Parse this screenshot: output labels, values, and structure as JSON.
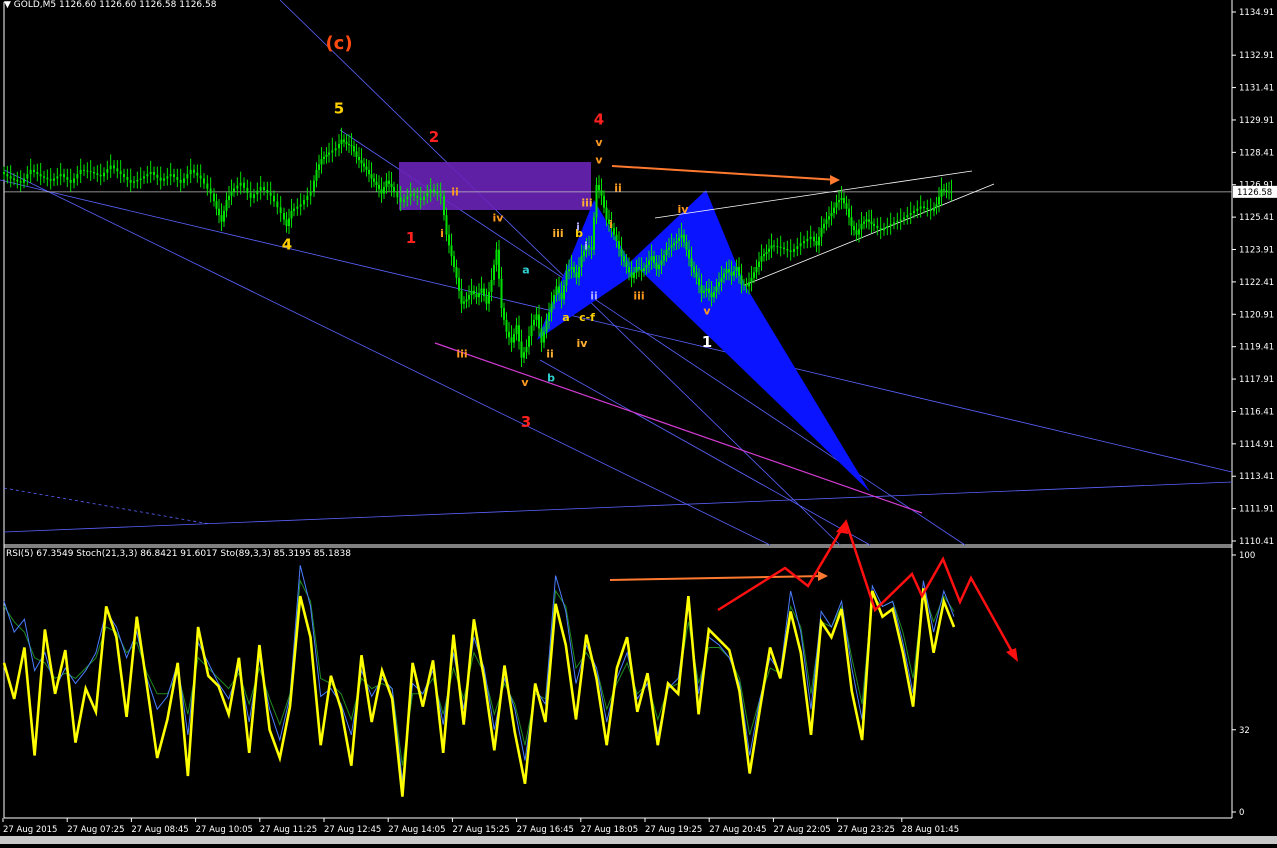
{
  "window": {
    "symbol_label": "GOLD,M5  1126.60 1126.60 1126.58 1126.58",
    "indicator_label": "RSI(5) 67.3549  Stoch(21,3,3) 86.8421 91.6017  Sto(89,3,3) 85.3195 85.1838"
  },
  "colors": {
    "bg": "#000000",
    "candle": "#00e000",
    "grid": "#ffffff",
    "price_line": "#c0c0c0",
    "trend_blue": "#5a63ff",
    "magenta": "#d23cd2",
    "zone_purple": "#6a24b8",
    "pattern_blue": "#0a14ff",
    "rsi_yellow": "#ffff00",
    "arrow_red": "#ff1010",
    "arrow_orange": "#ff7a30"
  },
  "chart_data": [
    {
      "type": "candlestick",
      "symbol": "GOLD",
      "timeframe": "M5",
      "ylim": [
        1110.41,
        1134.91
      ],
      "y_ticks": [
        "1134.91",
        "1132.91",
        "1131.41",
        "1129.91",
        "1128.41",
        "1126.91",
        "1125.41",
        "1123.91",
        "1122.41",
        "1120.91",
        "1119.41",
        "1117.91",
        "1116.41",
        "1114.91",
        "1113.41",
        "1111.91",
        "1110.41"
      ],
      "current_price": "1126.58",
      "x_labels": [
        "27 Aug 2015",
        "27 Aug 07:25",
        "27 Aug 08:45",
        "27 Aug 10:05",
        "27 Aug 11:25",
        "27 Aug 12:45",
        "27 Aug 14:05",
        "27 Aug 15:25",
        "27 Aug 16:45",
        "27 Aug 18:05",
        "27 Aug 19:25",
        "27 Aug 20:45",
        "27 Aug 22:05",
        "27 Aug 23:25",
        "28 Aug 01:45"
      ],
      "close_path": [
        [
          0,
          1127.5
        ],
        [
          10,
          1127.2
        ],
        [
          20,
          1127.0
        ],
        [
          30,
          1127.6
        ],
        [
          40,
          1127.3
        ],
        [
          50,
          1127.1
        ],
        [
          60,
          1127.4
        ],
        [
          70,
          1127.0
        ],
        [
          80,
          1127.6
        ],
        [
          90,
          1127.5
        ],
        [
          100,
          1127.3
        ],
        [
          110,
          1127.8
        ],
        [
          120,
          1127.4
        ],
        [
          130,
          1127.0
        ],
        [
          140,
          1127.2
        ],
        [
          150,
          1127.5
        ],
        [
          160,
          1127.1
        ],
        [
          170,
          1127.4
        ],
        [
          180,
          1127.0
        ],
        [
          190,
          1127.6
        ],
        [
          200,
          1127.2
        ],
        [
          210,
          1126.5
        ],
        [
          215,
          1125.8
        ],
        [
          220,
          1125.2
        ],
        [
          225,
          1126.2
        ],
        [
          230,
          1126.6
        ],
        [
          240,
          1127.0
        ],
        [
          250,
          1126.3
        ],
        [
          260,
          1126.8
        ],
        [
          270,
          1126.4
        ],
        [
          280,
          1125.6
        ],
        [
          285,
          1125.0
        ],
        [
          290,
          1125.7
        ],
        [
          300,
          1126.0
        ],
        [
          310,
          1126.6
        ],
        [
          315,
          1127.6
        ],
        [
          320,
          1128.1
        ],
        [
          325,
          1128.3
        ],
        [
          335,
          1128.6
        ],
        [
          340,
          1129.0
        ],
        [
          345,
          1128.8
        ],
        [
          350,
          1128.7
        ],
        [
          355,
          1128.2
        ],
        [
          360,
          1127.9
        ],
        [
          365,
          1127.6
        ],
        [
          370,
          1127.2
        ],
        [
          375,
          1126.9
        ],
        [
          380,
          1126.5
        ],
        [
          385,
          1127.1
        ],
        [
          390,
          1126.8
        ],
        [
          400,
          1126.1
        ],
        [
          410,
          1126.5
        ],
        [
          420,
          1126.2
        ],
        [
          430,
          1126.7
        ],
        [
          440,
          1126.4
        ],
        [
          445,
          1124.6
        ],
        [
          450,
          1123.6
        ],
        [
          455,
          1122.6
        ],
        [
          460,
          1121.4
        ],
        [
          465,
          1121.6
        ],
        [
          470,
          1122.0
        ],
        [
          475,
          1121.7
        ],
        [
          480,
          1122.1
        ],
        [
          485,
          1121.4
        ],
        [
          490,
          1122.5
        ],
        [
          495,
          1123.9
        ],
        [
          500,
          1121.2
        ],
        [
          505,
          1120.1
        ],
        [
          510,
          1119.6
        ],
        [
          515,
          1120.4
        ],
        [
          520,
          1118.9
        ],
        [
          525,
          1119.4
        ],
        [
          530,
          1120.4
        ],
        [
          535,
          1120.9
        ],
        [
          540,
          1119.6
        ],
        [
          545,
          1120.6
        ],
        [
          550,
          1121.4
        ],
        [
          555,
          1122.2
        ],
        [
          560,
          1121.6
        ],
        [
          565,
          1122.9
        ],
        [
          570,
          1123.1
        ],
        [
          575,
          1122.6
        ],
        [
          580,
          1123.6
        ],
        [
          585,
          1124.1
        ],
        [
          590,
          1123.9
        ],
        [
          595,
          1126.9
        ],
        [
          600,
          1126.4
        ],
        [
          605,
          1125.3
        ],
        [
          610,
          1124.9
        ],
        [
          615,
          1124.3
        ],
        [
          620,
          1123.6
        ],
        [
          625,
          1123.1
        ],
        [
          630,
          1122.6
        ],
        [
          635,
          1123.1
        ],
        [
          640,
          1122.9
        ],
        [
          645,
          1123.2
        ],
        [
          650,
          1123.6
        ],
        [
          655,
          1123.0
        ],
        [
          660,
          1123.4
        ],
        [
          665,
          1123.9
        ],
        [
          670,
          1124.1
        ],
        [
          675,
          1124.3
        ],
        [
          680,
          1124.6
        ],
        [
          685,
          1123.9
        ],
        [
          690,
          1123.1
        ],
        [
          695,
          1122.6
        ],
        [
          700,
          1121.9
        ],
        [
          705,
          1122.1
        ],
        [
          710,
          1121.7
        ],
        [
          715,
          1122.2
        ],
        [
          720,
          1122.6
        ],
        [
          725,
          1123.0
        ],
        [
          730,
          1122.7
        ],
        [
          735,
          1123.1
        ],
        [
          740,
          1122.3
        ],
        [
          745,
          1122.2
        ],
        [
          750,
          1122.6
        ],
        [
          755,
          1123.1
        ],
        [
          760,
          1123.6
        ],
        [
          765,
          1123.8
        ],
        [
          770,
          1124.1
        ],
        [
          780,
          1124.0
        ],
        [
          790,
          1123.8
        ],
        [
          800,
          1124.2
        ],
        [
          810,
          1124.5
        ],
        [
          815,
          1124.1
        ],
        [
          820,
          1124.9
        ],
        [
          825,
          1125.3
        ],
        [
          830,
          1125.6
        ],
        [
          835,
          1126.1
        ],
        [
          840,
          1126.3
        ],
        [
          845,
          1125.8
        ],
        [
          850,
          1125.0
        ],
        [
          855,
          1124.6
        ],
        [
          860,
          1125.1
        ],
        [
          865,
          1125.3
        ],
        [
          870,
          1125.1
        ],
        [
          880,
          1124.8
        ],
        [
          890,
          1125.1
        ],
        [
          900,
          1125.3
        ],
        [
          910,
          1125.6
        ],
        [
          920,
          1125.9
        ],
        [
          930,
          1125.7
        ],
        [
          935,
          1126.0
        ],
        [
          940,
          1126.7
        ],
        [
          945,
          1126.6
        ],
        [
          950,
          1126.58
        ]
      ],
      "annotations": [
        {
          "text": "(c)",
          "color": "#ff4a10",
          "price": 1133.2,
          "bar": 335
        },
        {
          "text": "5",
          "color": "#ffd000",
          "price": 1130.2,
          "bar": 335
        },
        {
          "text": "4",
          "color": "#ffd000",
          "price": 1123.9,
          "bar": 283
        },
        {
          "text": "2",
          "color": "#ff2020",
          "price": 1128.9,
          "bar": 430
        },
        {
          "text": "1",
          "color": "#ff2020",
          "price": 1124.2,
          "bar": 407
        },
        {
          "text": "ii",
          "color": "#ff9a20",
          "price": 1126.4,
          "bar": 451
        },
        {
          "text": "i",
          "color": "#ff9a20",
          "price": 1124.5,
          "bar": 438
        },
        {
          "text": "iv",
          "color": "#ff9a20",
          "price": 1125.2,
          "bar": 494
        },
        {
          "text": "iii",
          "color": "#ff9a20",
          "price": 1118.9,
          "bar": 458
        },
        {
          "text": "v",
          "color": "#ff9a20",
          "price": 1117.6,
          "bar": 521
        },
        {
          "text": "3",
          "color": "#ff2020",
          "price": 1115.7,
          "bar": 522
        },
        {
          "text": "a",
          "color": "#30d0d0",
          "price": 1122.8,
          "bar": 522
        },
        {
          "text": "b",
          "color": "#30d0d0",
          "price": 1117.8,
          "bar": 547
        },
        {
          "text": "iii",
          "color": "#ffb030",
          "price": 1124.5,
          "bar": 554
        },
        {
          "text": "b",
          "color": "#ffd000",
          "price": 1124.5,
          "bar": 575
        },
        {
          "text": "a",
          "color": "#ffd000",
          "price": 1120.6,
          "bar": 562
        },
        {
          "text": "c-f",
          "color": "#ffd000",
          "price": 1120.6,
          "bar": 583
        },
        {
          "text": "ii",
          "color": "#ffb030",
          "price": 1118.9,
          "bar": 546
        },
        {
          "text": "iv",
          "color": "#ffb030",
          "price": 1119.4,
          "bar": 578
        },
        {
          "text": "iii",
          "color": "#ffb030",
          "price": 1125.9,
          "bar": 583
        },
        {
          "text": "i",
          "color": "#b0b0ff",
          "price": 1124.8,
          "bar": 574
        },
        {
          "text": "i",
          "color": "#b0b0ff",
          "price": 1123.9,
          "bar": 582
        },
        {
          "text": "ii",
          "color": "#b0b0ff",
          "price": 1121.6,
          "bar": 590
        },
        {
          "text": "4",
          "color": "#ff2020",
          "price": 1129.7,
          "bar": 595
        },
        {
          "text": "v",
          "color": "#ff9a20",
          "price": 1128.7,
          "bar": 595
        },
        {
          "text": "v",
          "color": "#ff9a20",
          "price": 1127.9,
          "bar": 595
        },
        {
          "text": "ii",
          "color": "#ff9a20",
          "price": 1126.6,
          "bar": 614
        },
        {
          "text": "i",
          "color": "#ff9a20",
          "price": 1124.9,
          "bar": 607
        },
        {
          "text": "iii",
          "color": "#ff9a20",
          "price": 1121.6,
          "bar": 635
        },
        {
          "text": "iv",
          "color": "#ff9a20",
          "price": 1125.6,
          "bar": 679
        },
        {
          "text": "v",
          "color": "#ff9a20",
          "price": 1120.9,
          "bar": 703
        },
        {
          "text": "1",
          "color": "#ffffff",
          "price": 1119.4,
          "bar": 703
        }
      ]
    },
    {
      "type": "line",
      "indicator": "RSI / Stochastic",
      "ylim": [
        0,
        100
      ],
      "y_ticks": [
        "100",
        "32",
        "0"
      ],
      "series": [
        {
          "name": "RSI(5)",
          "color": "#ffff00",
          "values": [
            58,
            44,
            64,
            22,
            71,
            46,
            63,
            27,
            48,
            39,
            80,
            68,
            37,
            76,
            49,
            21,
            36,
            58,
            14,
            72,
            53,
            49,
            38,
            60,
            23,
            65,
            32,
            21,
            41,
            84,
            68,
            26,
            53,
            40,
            18,
            61,
            35,
            55,
            44,
            6,
            58,
            41,
            59,
            23,
            69,
            34,
            75,
            52,
            24,
            57,
            31,
            11,
            50,
            35,
            81,
            65,
            36,
            69,
            52,
            26,
            56,
            68,
            39,
            54,
            26,
            50,
            46,
            84,
            38,
            71,
            67,
            63,
            47,
            15,
            40,
            64,
            52,
            78,
            62,
            30,
            74,
            68,
            79,
            47,
            28,
            86,
            76,
            79,
            62,
            41,
            87,
            62,
            82,
            72
          ]
        },
        {
          "name": "Stoch(21,3,3)",
          "color": "#4a7dff",
          "values": [
            82,
            70,
            75,
            55,
            62,
            48,
            56,
            50,
            55,
            62,
            78,
            72,
            60,
            70,
            52,
            40,
            45,
            58,
            30,
            66,
            58,
            50,
            44,
            56,
            35,
            60,
            40,
            28,
            45,
            96,
            80,
            45,
            48,
            42,
            30,
            55,
            45,
            52,
            48,
            12,
            50,
            46,
            55,
            34,
            62,
            40,
            68,
            56,
            32,
            52,
            40,
            20,
            48,
            42,
            92,
            78,
            50,
            65,
            56,
            35,
            52,
            62,
            44,
            50,
            30,
            48,
            52,
            80,
            46,
            68,
            65,
            60,
            50,
            22,
            44,
            60,
            54,
            86,
            70,
            40,
            78,
            72,
            82,
            56,
            36,
            88,
            80,
            82,
            66,
            46,
            90,
            70,
            86,
            76
          ]
        },
        {
          "name": "Sto(89,3,3)",
          "color": "#208a20",
          "values": [
            80,
            74,
            70,
            60,
            58,
            52,
            54,
            52,
            56,
            60,
            72,
            70,
            62,
            66,
            54,
            46,
            46,
            54,
            38,
            60,
            56,
            52,
            48,
            54,
            42,
            56,
            44,
            34,
            46,
            90,
            82,
            52,
            50,
            46,
            36,
            52,
            48,
            50,
            48,
            18,
            46,
            46,
            52,
            38,
            56,
            44,
            62,
            54,
            38,
            50,
            42,
            26,
            46,
            44,
            86,
            80,
            56,
            62,
            56,
            40,
            50,
            58,
            46,
            50,
            36,
            48,
            50,
            74,
            50,
            64,
            64,
            60,
            52,
            30,
            44,
            56,
            54,
            80,
            72,
            46,
            74,
            72,
            80,
            60,
            42,
            84,
            80,
            82,
            70,
            52,
            86,
            74,
            84,
            78
          ]
        }
      ]
    }
  ]
}
